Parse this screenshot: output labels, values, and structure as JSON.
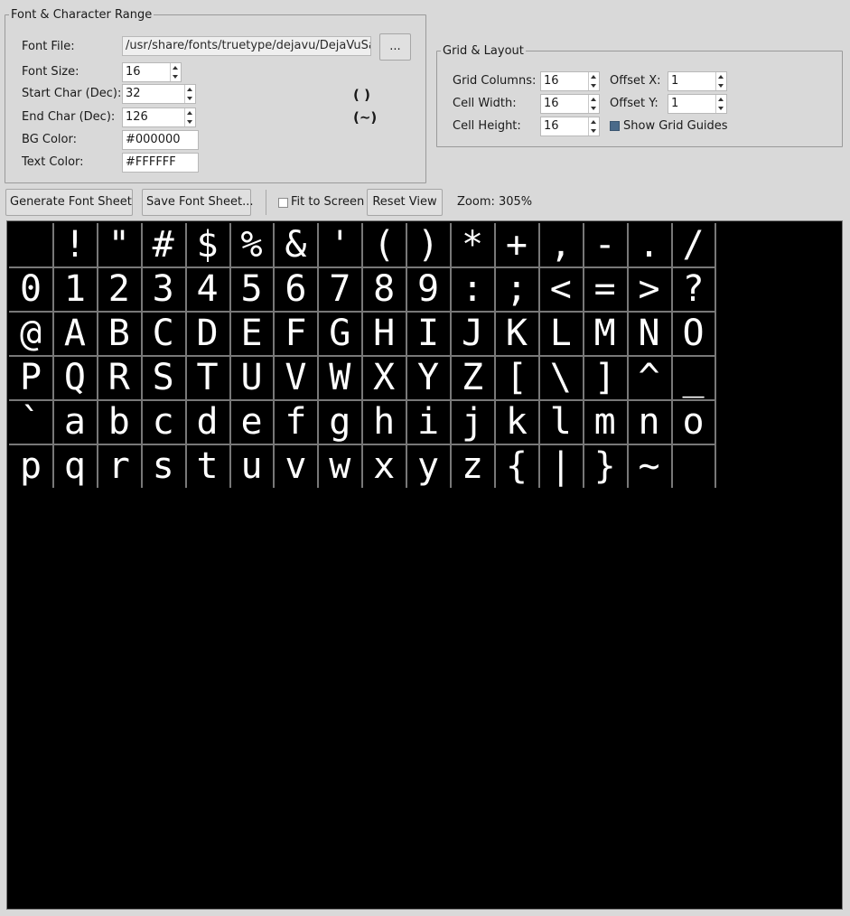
{
  "font_group": {
    "legend": "Font & Character Range",
    "font_file_label": "Font File:",
    "font_file_value": "/usr/share/fonts/truetype/dejavu/DejaVuSa",
    "browse_label": "...",
    "font_size_label": "Font Size:",
    "font_size_value": "16",
    "start_char_label": "Start Char (Dec):",
    "start_char_value": "32",
    "start_char_preview": "( )",
    "end_char_label": "End Char (Dec):",
    "end_char_value": "126",
    "end_char_preview": "(~)",
    "bg_color_label": "BG Color:",
    "bg_color_value": "#000000",
    "text_color_label": "Text Color:",
    "text_color_value": "#FFFFFF"
  },
  "grid_group": {
    "legend": "Grid & Layout",
    "columns_label": "Grid Columns:",
    "columns_value": "16",
    "cell_width_label": "Cell Width:",
    "cell_width_value": "16",
    "cell_height_label": "Cell Height:",
    "cell_height_value": "16",
    "offset_x_label": "Offset X:",
    "offset_x_value": "1",
    "offset_y_label": "Offset Y:",
    "offset_y_value": "1",
    "show_guides_label": "Show Grid Guides",
    "show_guides_checked": true
  },
  "toolbar": {
    "generate_label": "Generate Font Sheet",
    "save_label": "Save Font Sheet...",
    "fit_label": "Fit to Screen",
    "fit_checked": false,
    "reset_label": "Reset View",
    "zoom_text": "Zoom: 305%"
  },
  "sheet": {
    "columns": 16,
    "rows": 6,
    "characters": " !\"#$%&'()*+,-./0123456789:;<=>?@ABCDEFGHIJKLMNOPQRSTUVWXYZ[\\]^_`abcdefghijklmnopqrstuvwxyz{|}~",
    "bg_color": "#000000",
    "text_color": "#FFFFFF",
    "guide_color": "#787878"
  }
}
